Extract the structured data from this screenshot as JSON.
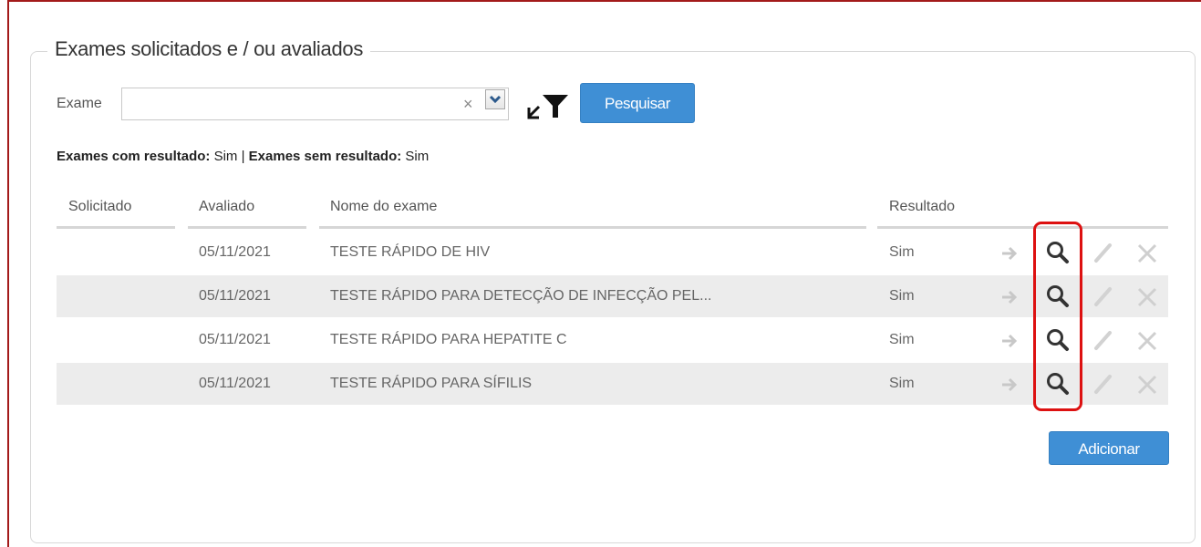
{
  "panel": {
    "title": "Exames solicitados e / ou avaliados"
  },
  "search": {
    "label": "Exame",
    "selected_value": "",
    "clear_glyph": "×",
    "search_button_label": "Pesquisar"
  },
  "filters": {
    "with_result_label": "Exames com resultado:",
    "with_result_value": "Sim",
    "separator": "|",
    "without_result_label": "Exames sem resultado:",
    "without_result_value": "Sim"
  },
  "table": {
    "columns": [
      "Solicitado",
      "Avaliado",
      "Nome do exame",
      "Resultado"
    ],
    "rows": [
      {
        "solicitado": "",
        "avaliado": "05/11/2021",
        "nome": "TESTE RÁPIDO DE HIV",
        "resultado": "Sim"
      },
      {
        "solicitado": "",
        "avaliado": "05/11/2021",
        "nome": "TESTE RÁPIDO PARA DETECÇÃO DE INFECÇÃO PEL...",
        "resultado": "Sim"
      },
      {
        "solicitado": "",
        "avaliado": "05/11/2021",
        "nome": "TESTE RÁPIDO PARA HEPATITE C",
        "resultado": "Sim"
      },
      {
        "solicitado": "",
        "avaliado": "05/11/2021",
        "nome": "TESTE RÁPIDO PARA SÍFILIS",
        "resultado": "Sim"
      }
    ],
    "row_actions": [
      "arrow-right-icon",
      "magnifier-icon",
      "pencil-icon",
      "close-icon"
    ]
  },
  "footer": {
    "add_button_label": "Adicionar"
  },
  "colors": {
    "primary_button": "#3f8fd5",
    "highlight_annotation": "#dd1111",
    "frame_border": "#a31a1a",
    "alt_row": "#ececec"
  }
}
